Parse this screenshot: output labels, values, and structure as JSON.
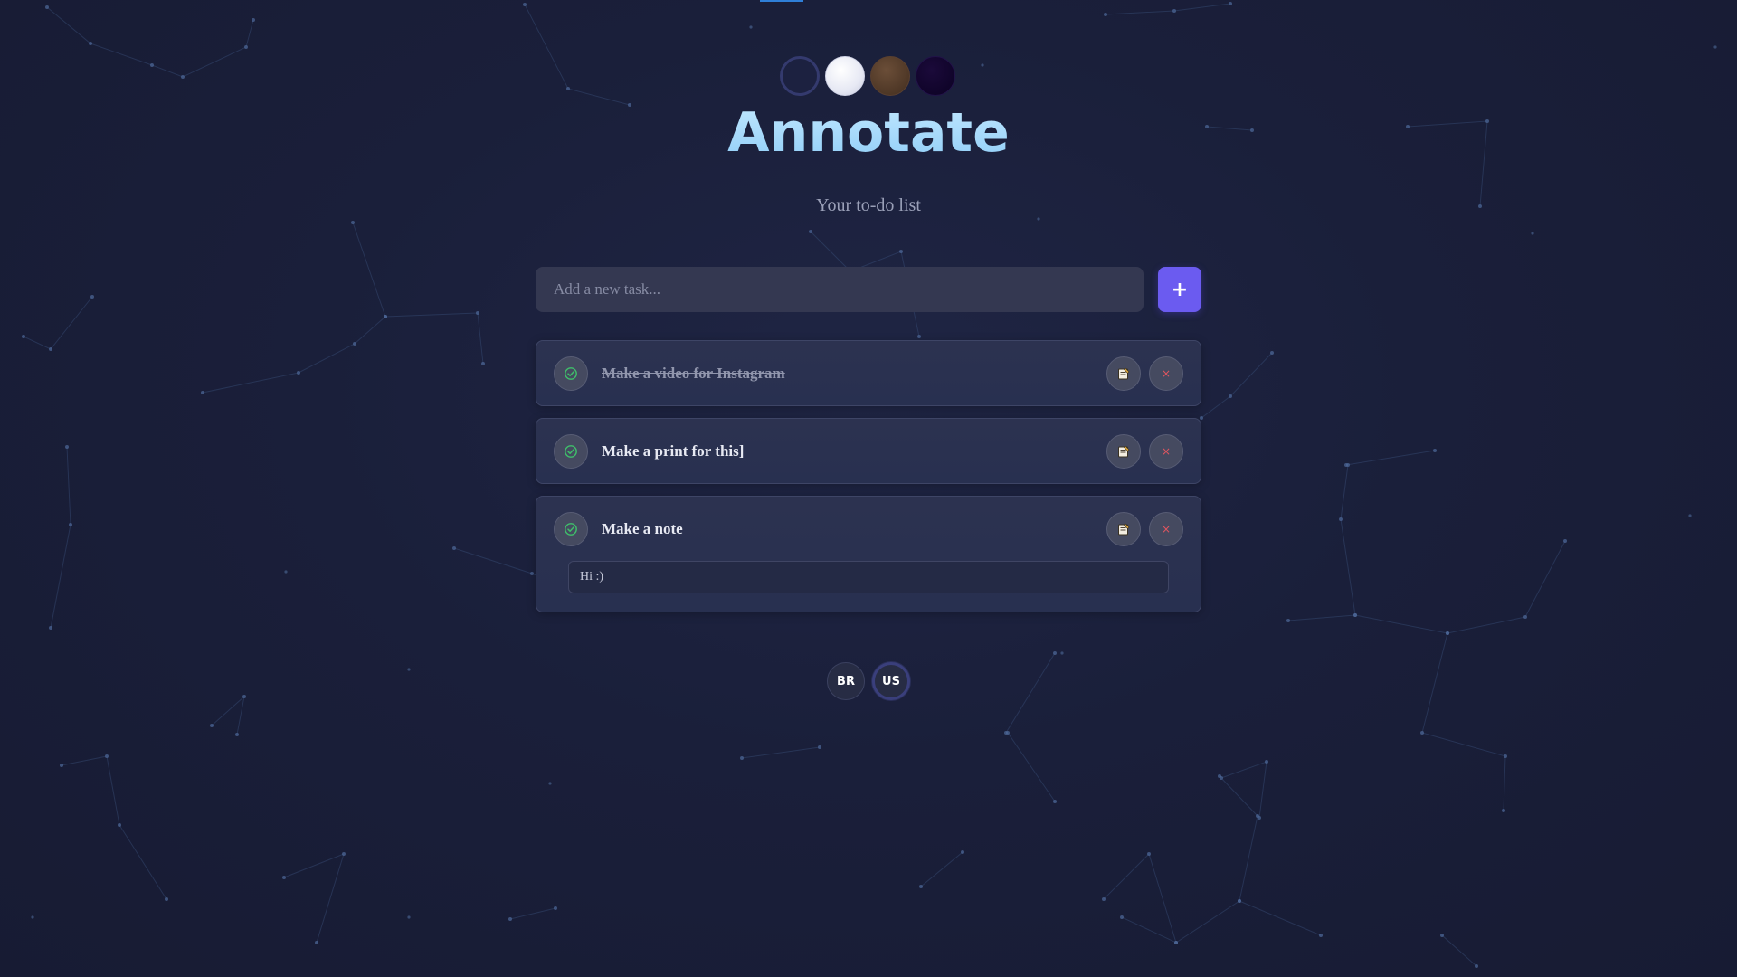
{
  "app": {
    "title": "Annotate",
    "subtitle": "Your to-do list"
  },
  "themes": [
    {
      "name": "dark-navy",
      "color": "#1c2140",
      "active": true
    },
    {
      "name": "light",
      "color": "#f2f3f9",
      "active": false
    },
    {
      "name": "brown",
      "color": "#5a4030",
      "active": false
    },
    {
      "name": "deep-purple",
      "color": "#14062e",
      "active": false
    }
  ],
  "add_task": {
    "placeholder": "Add a new task...",
    "value": "",
    "button_label": "+"
  },
  "tasks": [
    {
      "text": "Make a video for Instagram",
      "completed": true,
      "note": null
    },
    {
      "text": "Make a print for this]",
      "completed": false,
      "note": null
    },
    {
      "text": "Make a note",
      "completed": false,
      "note": "Hi :)"
    }
  ],
  "icons": {
    "check": "check-circle-icon",
    "note": "note-icon",
    "delete": "close-icon",
    "delete_glyph": "×"
  },
  "languages": [
    {
      "code": "BR",
      "active": false
    },
    {
      "code": "US",
      "active": true
    }
  ],
  "colors": {
    "accent": "#6b5bf0",
    "title": "#a9dcff",
    "check_green": "#3fbf6a",
    "delete_red": "#e0555f",
    "background": "#1a1f3a"
  }
}
